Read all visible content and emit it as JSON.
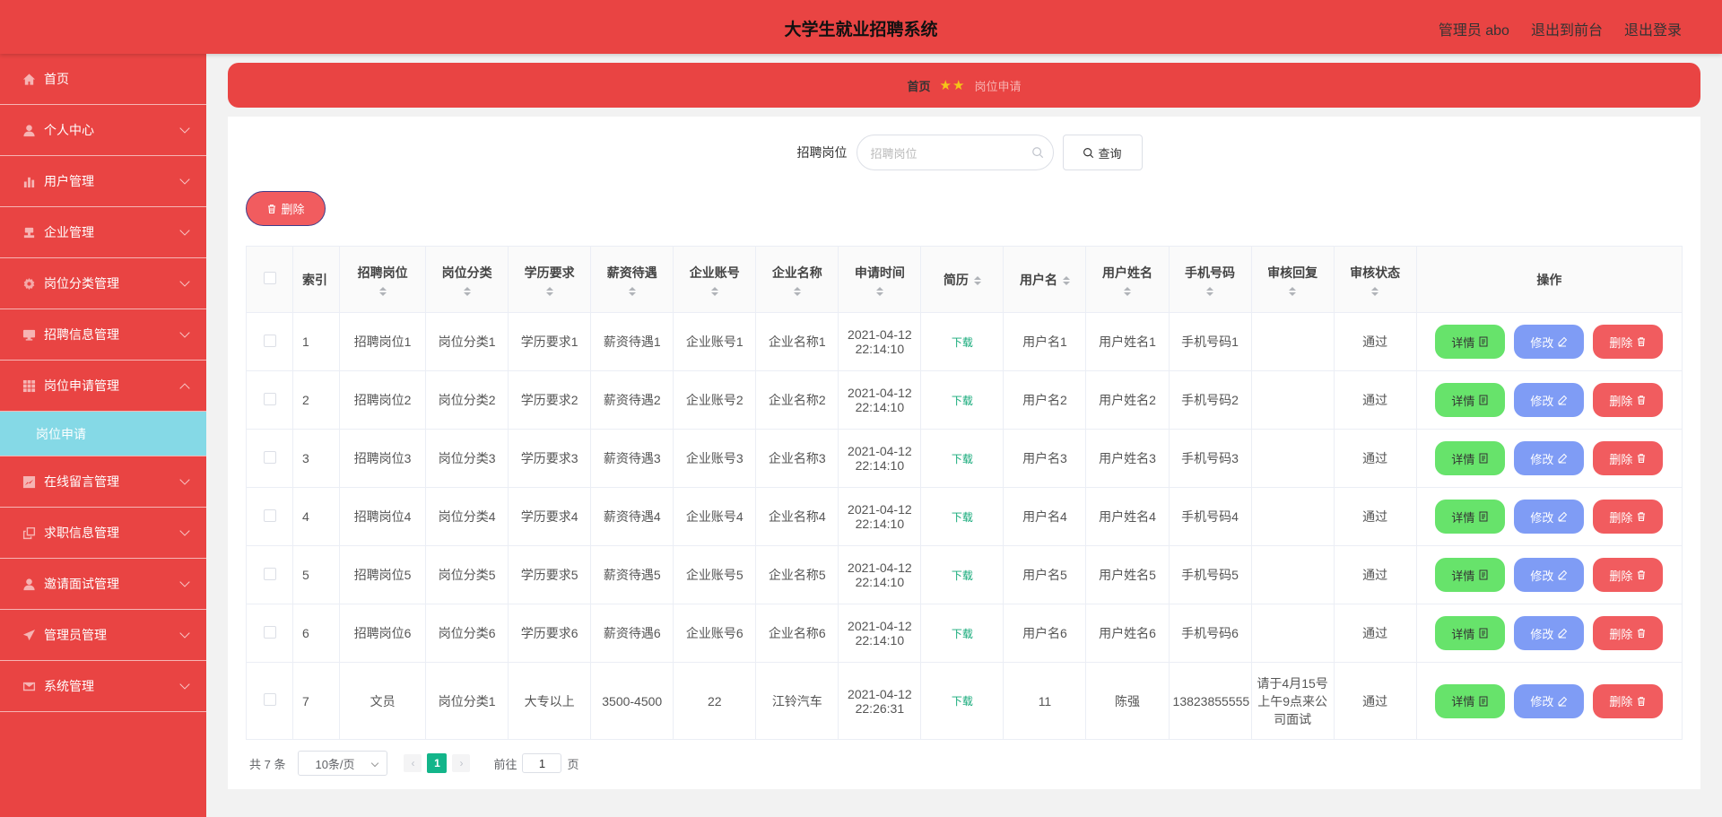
{
  "header": {
    "title": "大学生就业招聘系统",
    "user": "管理员 abo",
    "to_front": "退出到前台",
    "logout": "退出登录"
  },
  "sidebar": {
    "items": [
      {
        "label": "首页",
        "icon": "home-icon"
      },
      {
        "label": "个人中心",
        "icon": "user-icon"
      },
      {
        "label": "用户管理",
        "icon": "bar-chart-icon"
      },
      {
        "label": "企业管理",
        "icon": "stamp-icon"
      },
      {
        "label": "岗位分类管理",
        "icon": "settings-icon"
      },
      {
        "label": "招聘信息管理",
        "icon": "monitor-icon"
      },
      {
        "label": "岗位申请管理",
        "icon": "grid-icon"
      },
      {
        "label": "在线留言管理",
        "icon": "chart-box-icon"
      },
      {
        "label": "求职信息管理",
        "icon": "copy-icon"
      },
      {
        "label": "邀请面试管理",
        "icon": "user-icon"
      },
      {
        "label": "管理员管理",
        "icon": "send-icon"
      },
      {
        "label": "系统管理",
        "icon": "mail-icon"
      }
    ],
    "sub_active": "岗位申请"
  },
  "breadcrumb": {
    "home": "首页",
    "stars": "★★",
    "current": "岗位申请"
  },
  "search": {
    "label": "招聘岗位",
    "placeholder": "招聘岗位",
    "button": "查询"
  },
  "toolbar": {
    "delete": "删除"
  },
  "table": {
    "headers": [
      "索引",
      "招聘岗位",
      "岗位分类",
      "学历要求",
      "薪资待遇",
      "企业账号",
      "企业名称",
      "申请时间",
      "简历",
      "用户名",
      "用户姓名",
      "手机号码",
      "审核回复",
      "审核状态",
      "操作"
    ],
    "rows": [
      {
        "idx": "1",
        "job": "招聘岗位1",
        "cat": "岗位分类1",
        "edu": "学历要求1",
        "salary": "薪资待遇1",
        "acct": "企业账号1",
        "company": "企业名称1",
        "time": "2021-04-12 22:14:10",
        "resume": "下载",
        "username": "用户名1",
        "name": "用户姓名1",
        "phone": "手机号码1",
        "reply": "",
        "status": "通过"
      },
      {
        "idx": "2",
        "job": "招聘岗位2",
        "cat": "岗位分类2",
        "edu": "学历要求2",
        "salary": "薪资待遇2",
        "acct": "企业账号2",
        "company": "企业名称2",
        "time": "2021-04-12 22:14:10",
        "resume": "下载",
        "username": "用户名2",
        "name": "用户姓名2",
        "phone": "手机号码2",
        "reply": "",
        "status": "通过"
      },
      {
        "idx": "3",
        "job": "招聘岗位3",
        "cat": "岗位分类3",
        "edu": "学历要求3",
        "salary": "薪资待遇3",
        "acct": "企业账号3",
        "company": "企业名称3",
        "time": "2021-04-12 22:14:10",
        "resume": "下载",
        "username": "用户名3",
        "name": "用户姓名3",
        "phone": "手机号码3",
        "reply": "",
        "status": "通过"
      },
      {
        "idx": "4",
        "job": "招聘岗位4",
        "cat": "岗位分类4",
        "edu": "学历要求4",
        "salary": "薪资待遇4",
        "acct": "企业账号4",
        "company": "企业名称4",
        "time": "2021-04-12 22:14:10",
        "resume": "下载",
        "username": "用户名4",
        "name": "用户姓名4",
        "phone": "手机号码4",
        "reply": "",
        "status": "通过"
      },
      {
        "idx": "5",
        "job": "招聘岗位5",
        "cat": "岗位分类5",
        "edu": "学历要求5",
        "salary": "薪资待遇5",
        "acct": "企业账号5",
        "company": "企业名称5",
        "time": "2021-04-12 22:14:10",
        "resume": "下载",
        "username": "用户名5",
        "name": "用户姓名5",
        "phone": "手机号码5",
        "reply": "",
        "status": "通过"
      },
      {
        "idx": "6",
        "job": "招聘岗位6",
        "cat": "岗位分类6",
        "edu": "学历要求6",
        "salary": "薪资待遇6",
        "acct": "企业账号6",
        "company": "企业名称6",
        "time": "2021-04-12 22:14:10",
        "resume": "下载",
        "username": "用户名6",
        "name": "用户姓名6",
        "phone": "手机号码6",
        "reply": "",
        "status": "通过"
      },
      {
        "idx": "7",
        "job": "文员",
        "cat": "岗位分类1",
        "edu": "大专以上",
        "salary": "3500-4500",
        "acct": "22",
        "company": "江铃汽车",
        "time": "2021-04-12 22:26:31",
        "resume": "下载",
        "username": "11",
        "name": "陈强",
        "phone": "13823855555",
        "reply": "请于4月15号上午9点来公司面试",
        "status": "通过"
      }
    ],
    "actions": {
      "detail": "详情",
      "edit": "修改",
      "delete": "删除"
    }
  },
  "pagination": {
    "total": "共 7 条",
    "page_size": "10条/页",
    "current_page": "1",
    "goto_label": "前往",
    "goto_value": "1",
    "page_unit": "页",
    "prev": "‹",
    "next": "›"
  }
}
